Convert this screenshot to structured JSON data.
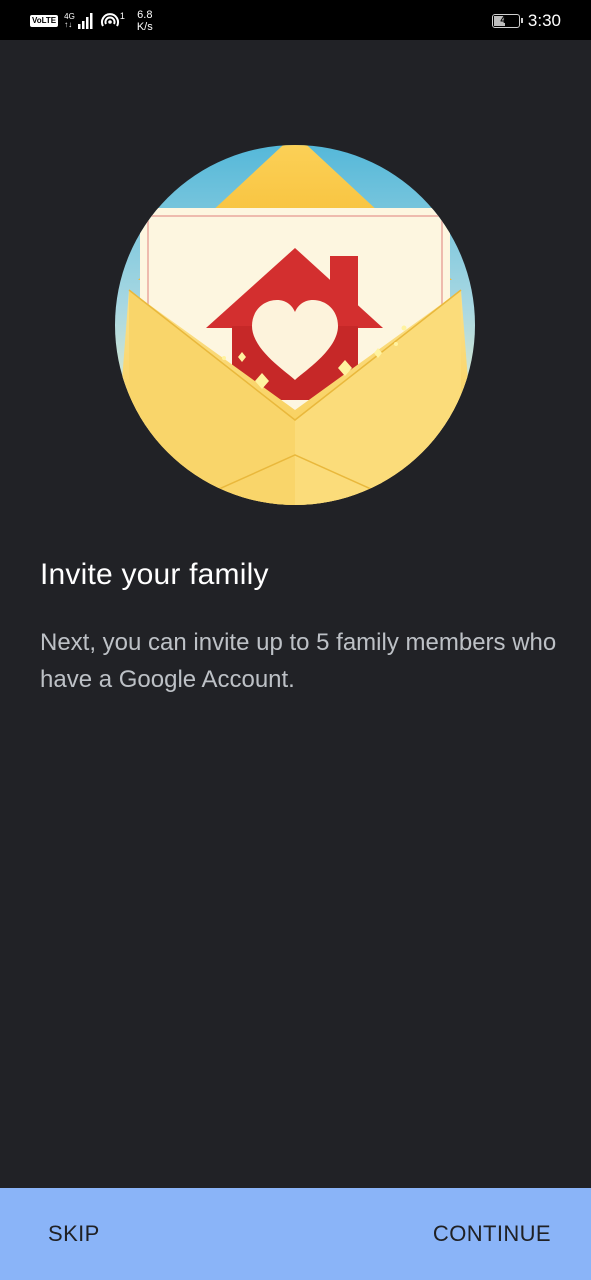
{
  "status_bar": {
    "volte": "VoLTE",
    "network_type": "4G",
    "network_sub": "↑↓",
    "hotspot_count": "1",
    "speed_value": "6.8",
    "speed_unit": "K/s",
    "battery_level": "48",
    "battery_fraction": 0.48,
    "time": "3:30"
  },
  "content": {
    "title": "Invite your family",
    "body": "Next, you can invite up to 5 family members who have a Google Account."
  },
  "actions": {
    "skip_label": "SKIP",
    "continue_label": "CONTINUE"
  },
  "icons": {
    "signal": "signal-bars-icon",
    "hotspot": "hotspot-icon",
    "battery": "battery-icon",
    "illustration": "envelope-house-heart-illustration"
  },
  "colors": {
    "background": "#212226",
    "status_bar": "#000000",
    "bottom_bar": "#8ab4f8",
    "title_text": "#ffffff",
    "body_text": "#bdc1c6",
    "button_text": "#202124"
  }
}
